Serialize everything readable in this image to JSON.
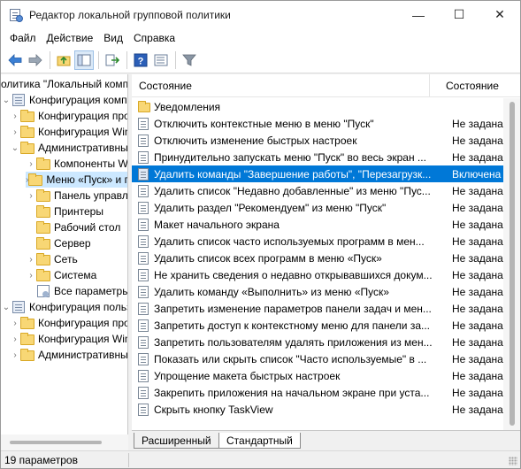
{
  "window": {
    "title": "Редактор локальной групповой политики",
    "controls": {
      "minimize": "—",
      "maximize": "☐",
      "close": "✕"
    }
  },
  "menu": [
    "Файл",
    "Действие",
    "Вид",
    "Справка"
  ],
  "toolbar": {
    "icons": [
      "back-arrow-icon",
      "forward-arrow-icon",
      "up-folder-icon",
      "show-hide-tree-icon",
      "export-list-icon",
      "help-icon",
      "properties-icon",
      "filter-icon"
    ]
  },
  "tree": [
    {
      "label": "олитика \"Локальный комп",
      "icon": "none",
      "expander": ""
    },
    {
      "label": "Конфигурация компьютера",
      "icon": "config",
      "expander": "⌄"
    },
    {
      "label": "Конфигурация прогр",
      "icon": "folder",
      "expander": "›"
    },
    {
      "label": "Конфигурация Windo",
      "icon": "folder",
      "expander": "›"
    },
    {
      "label": "Административные",
      "icon": "folder",
      "expander": "⌄"
    },
    {
      "label": "Компоненты Wind",
      "icon": "folder",
      "expander": "›"
    },
    {
      "label": "Меню «Пуск» и п",
      "icon": "folder",
      "expander": "›",
      "selected": true
    },
    {
      "label": "Панель управлен",
      "icon": "folder",
      "expander": "›"
    },
    {
      "label": "Принтеры",
      "icon": "folder",
      "expander": ""
    },
    {
      "label": "Рабочий стол",
      "icon": "folder",
      "expander": "›"
    },
    {
      "label": "Сервер",
      "icon": "folder",
      "expander": ""
    },
    {
      "label": "Сеть",
      "icon": "folder",
      "expander": "›"
    },
    {
      "label": "Система",
      "icon": "folder",
      "expander": "›"
    },
    {
      "label": "Все параметры",
      "icon": "allsettings",
      "expander": ""
    },
    {
      "label": "Конфигурация пользова",
      "icon": "config",
      "expander": "⌄"
    },
    {
      "label": "Конфигурация прогр",
      "icon": "folder",
      "expander": "›"
    },
    {
      "label": "Конфигурация Windo",
      "icon": "folder",
      "expander": "›"
    },
    {
      "label": "Административные",
      "icon": "folder",
      "expander": "›"
    }
  ],
  "list": {
    "header": {
      "name": "Состояние",
      "state": "Состояние"
    },
    "rows": [
      {
        "name": "Уведомления",
        "state": "",
        "icon": "folder"
      },
      {
        "name": "Отключить контекстные меню в меню \"Пуск\"",
        "state": "Не задана",
        "icon": "policy"
      },
      {
        "name": "Отключить изменение быстрых настроек",
        "state": "Не задана",
        "icon": "policy"
      },
      {
        "name": "Принудительно запускать меню \"Пуск\" во весь экран ...",
        "state": "Не задана",
        "icon": "policy"
      },
      {
        "name": "Удалить команды \"Завершение работы\", \"Перезагрузк...",
        "state": "Включена",
        "icon": "policy",
        "selected": true
      },
      {
        "name": "Удалить список \"Недавно добавленные\" из меню \"Пус...",
        "state": "Не задана",
        "icon": "policy"
      },
      {
        "name": "Удалить раздел \"Рекомендуем\" из меню \"Пуск\"",
        "state": "Не задана",
        "icon": "policy"
      },
      {
        "name": "Макет начального экрана",
        "state": "Не задана",
        "icon": "policy"
      },
      {
        "name": "Удалить список часто используемых программ в мен...",
        "state": "Не задана",
        "icon": "policy"
      },
      {
        "name": "Удалить список всех программ в меню «Пуск»",
        "state": "Не задана",
        "icon": "policy"
      },
      {
        "name": "Не хранить сведения о недавно открывавшихся докум...",
        "state": "Не задана",
        "icon": "policy"
      },
      {
        "name": "Удалить команду «Выполнить» из меню «Пуск»",
        "state": "Не задана",
        "icon": "policy"
      },
      {
        "name": "Запретить изменение параметров панели задач и мен...",
        "state": "Не задана",
        "icon": "policy"
      },
      {
        "name": "Запретить доступ к контекстному меню для панели за...",
        "state": "Не задана",
        "icon": "policy"
      },
      {
        "name": "Запретить пользователям удалять приложения из мен...",
        "state": "Не задана",
        "icon": "policy"
      },
      {
        "name": "Показать или скрыть список \"Часто используемые\" в ...",
        "state": "Не задана",
        "icon": "policy"
      },
      {
        "name": "Упрощение макета быстрых настроек",
        "state": "Не задана",
        "icon": "policy"
      },
      {
        "name": "Закрепить приложения на начальном экране при уста...",
        "state": "Не задана",
        "icon": "policy"
      },
      {
        "name": "Скрыть кнопку TaskView",
        "state": "Не задана",
        "icon": "policy"
      }
    ]
  },
  "tabs": [
    {
      "label": "Расширенный",
      "active": false
    },
    {
      "label": "Стандартный",
      "active": true
    }
  ],
  "status": {
    "text": "19 параметров"
  }
}
